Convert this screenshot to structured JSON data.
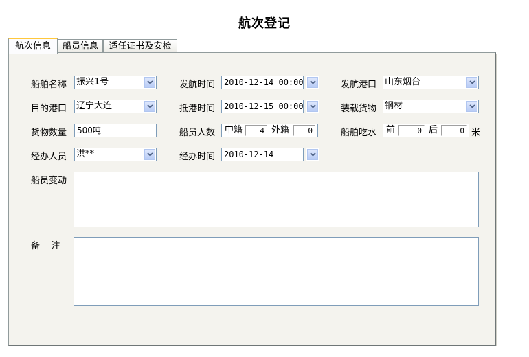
{
  "window": {
    "title": "航次登记"
  },
  "tabs": [
    {
      "label": "航次信息",
      "active": true
    },
    {
      "label": "船员信息",
      "active": false
    },
    {
      "label": "适任证书及安检",
      "active": false
    }
  ],
  "form": {
    "ship_name": {
      "label": "船舶名称",
      "value": "振兴1号"
    },
    "depart_time": {
      "label": "发航时间",
      "value": "2010-12-14 00:00"
    },
    "depart_port": {
      "label": "发航港口",
      "value": "山东烟台"
    },
    "dest_port": {
      "label": "目的港口",
      "value": "辽宁大连"
    },
    "arrive_time": {
      "label": "抵港时间",
      "value": "2010-12-15 00:00"
    },
    "cargo": {
      "label": "装载货物",
      "value": "钢材"
    },
    "cargo_qty": {
      "label": "货物数量",
      "value": "500吨"
    },
    "crew_count": {
      "label": "船员人数",
      "domestic_label": "中籍",
      "domestic": "4",
      "foreign_label": "外籍",
      "foreign": "0"
    },
    "draft": {
      "label": "船舶吃水",
      "front_label": "前",
      "front": "0",
      "rear_label": "后",
      "rear": "0",
      "unit": "米"
    },
    "handler": {
      "label": "经办人员",
      "value": "洪**"
    },
    "handle_time": {
      "label": "经办时间",
      "value": "2010-12-14"
    },
    "crew_changes": {
      "label": "船员变动",
      "value": ""
    },
    "remarks": {
      "label": "备    注",
      "value": ""
    }
  },
  "icons": {
    "dropdown": "chevron-down-icon"
  },
  "colors": {
    "tab_accent": "#ffc83c",
    "panel_bg": "#f4f3ee",
    "field_border": "#7f9db9"
  }
}
